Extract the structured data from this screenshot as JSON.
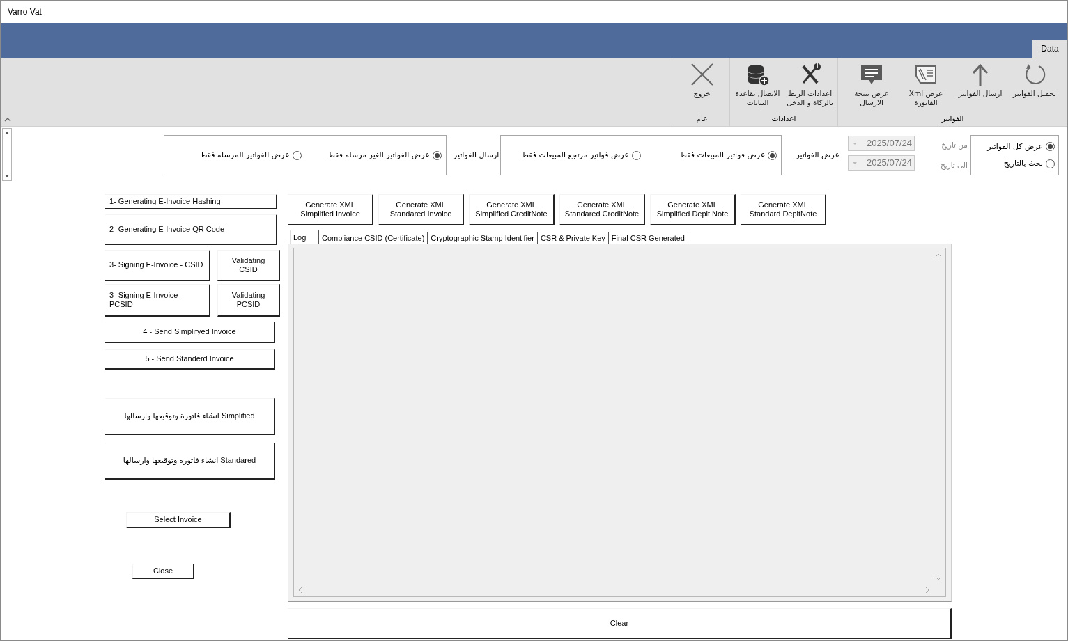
{
  "window": {
    "title": "Varro Vat"
  },
  "ribbon": {
    "tabs": [
      {
        "label": "Data",
        "selected": true
      }
    ],
    "groups": [
      {
        "label": "الفواتير",
        "buttons": [
          {
            "label": "تحميل الفواتير",
            "kind": "reload"
          },
          {
            "label": "ارسال الفواتير",
            "kind": "upload"
          },
          {
            "label": "عرض Xml\nالفاتورة",
            "kind": "xml"
          },
          {
            "label": "عرض نتيجة\nالارسال",
            "kind": "message"
          }
        ]
      },
      {
        "label": "اعدادات",
        "buttons": [
          {
            "label": "اعدادات الربط\nبالزكاة و الدخل",
            "kind": "tools"
          },
          {
            "label": "الاتصال بقاعدة\nالبيانات",
            "kind": "database"
          }
        ]
      },
      {
        "label": "عام",
        "buttons": [
          {
            "label": "خروج",
            "kind": "close"
          }
        ]
      }
    ]
  },
  "date_filter": {
    "options": [
      {
        "label": "عرض كل الفواتير",
        "selected": true
      },
      {
        "label": "بحث بالتاريخ",
        "selected": false
      }
    ],
    "dates": [
      {
        "label": "من تاريخ",
        "value": "2025/07/24",
        "disabled": true
      },
      {
        "label": "الى تاريخ",
        "value": "2025/07/24",
        "disabled": true
      }
    ]
  },
  "show_filter": {
    "label": "عرض الفواتير",
    "options": [
      {
        "label": "عرض فواتير المبيعات فقط",
        "selected": true
      },
      {
        "label": "عرض فواتير مرتجع المبيعات فقط",
        "selected": false
      }
    ]
  },
  "send_filter": {
    "label": "ارسال الفواتير",
    "options": [
      {
        "label": "عرض الفواتير الغير مرسله فقط",
        "selected": true
      },
      {
        "label": "عرض الفواتير المرسله فقط",
        "selected": false
      }
    ]
  },
  "left_buttons": [
    [
      "1- Generating E-Invoice Hashing"
    ],
    [
      "2- Generating E-Invoice QR Code"
    ],
    [
      "Validating CSID",
      "3- Signing E-Invoice - CSID"
    ],
    [
      "Validating\nPCSID",
      "3- Signing E-Invoice -\nPCSID"
    ],
    [
      "4 - Send Simplifyed Invoice"
    ],
    [
      "5 - Send Standerd Invoice"
    ],
    [
      "انشاء فاتورة وتوقيعها وارسالها Simplified"
    ],
    [
      "انشاء فاتورة وتوقيعها وارسالها Standared"
    ],
    [
      "Select Invoice"
    ],
    [
      "Close"
    ]
  ],
  "generate_buttons": [
    "Generate XML\nStandard DepitNote",
    "Generate XML\nSimplified Depit Note",
    "Generate XML\nStandared CreditNote",
    "Generate XML\nSimplified CreditNote",
    "Generate XML\nStandared Invoice",
    "Generate XML\nSimplified Invoice"
  ],
  "log_tabs": [
    {
      "label": "Final CSR Generated",
      "selected": false
    },
    {
      "label": "CSR & Private Key",
      "selected": false
    },
    {
      "label": "Cryptographic Stamp Identifier",
      "selected": false
    },
    {
      "label": "Compliance CSID (Certificate)",
      "selected": false
    },
    {
      "label": "Log",
      "selected": true
    }
  ],
  "clear_button": "Clear"
}
